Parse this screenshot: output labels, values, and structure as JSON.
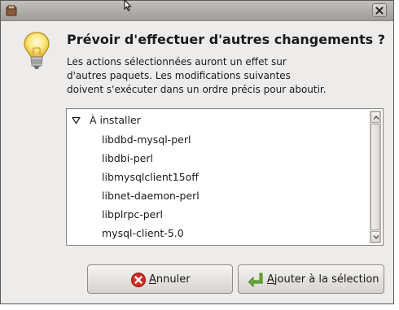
{
  "window": {
    "title": "",
    "close_symbol": "×"
  },
  "dialog": {
    "heading": "Prévoir d'effectuer d'autres changements ?",
    "description_lines": [
      "Les actions sélectionnées auront un effet sur",
      "d'autres paquets. Les modifications suivantes",
      "doivent s'exécuter dans un ordre précis pour aboutir."
    ]
  },
  "changes": {
    "group_label": "À installer",
    "packages": [
      "libdbd-mysql-perl",
      "libdbi-perl",
      "libmysqlclient15off",
      "libnet-daemon-perl",
      "libplrpc-perl",
      "mysql-client-5.0"
    ]
  },
  "buttons": {
    "cancel": {
      "mnemonic": "A",
      "rest": "nnuler",
      "icon": "cancel-icon"
    },
    "confirm": {
      "mnemonic": "A",
      "rest": "jouter à la sélection",
      "icon": "apply-arrow-icon"
    }
  },
  "colors": {
    "dialog_bg": "#edeceb",
    "cancel_red": "#d42a20",
    "confirm_green": "#5aa02c"
  }
}
